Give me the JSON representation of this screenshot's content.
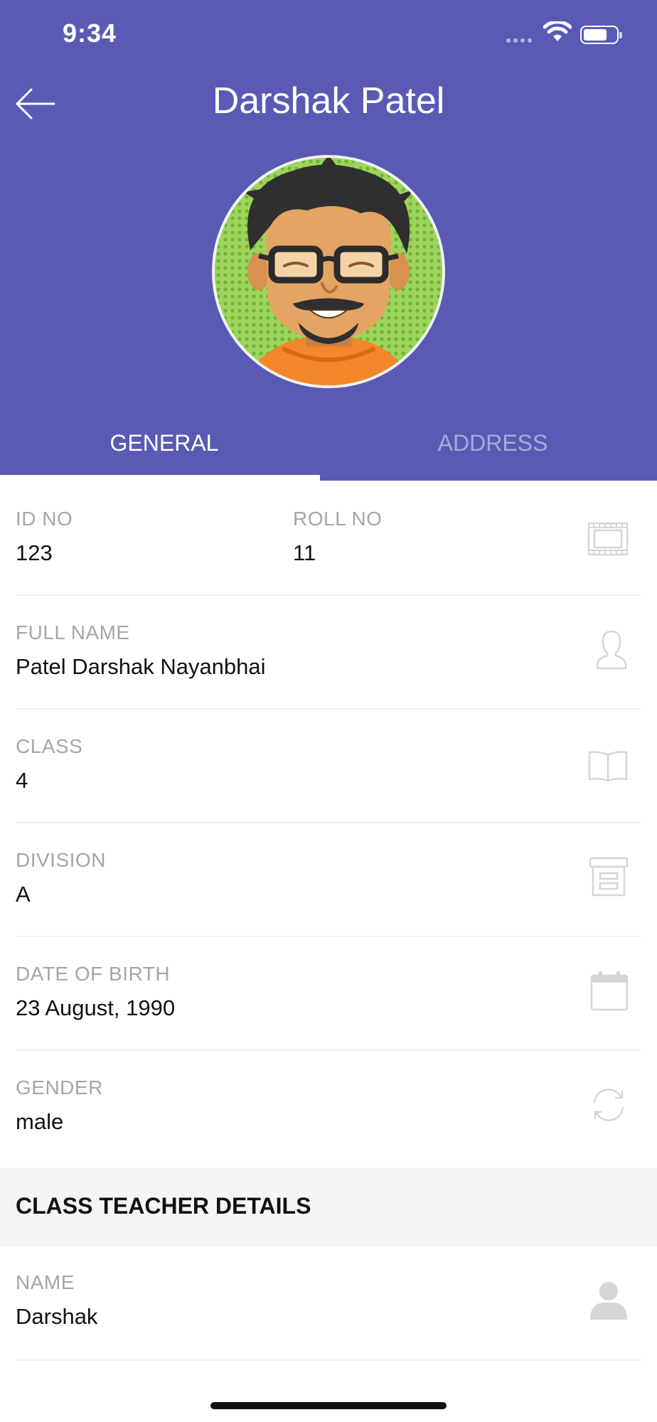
{
  "status_bar": {
    "time": "9:34"
  },
  "header": {
    "title": "Darshak Patel",
    "color": "#5a5ab5"
  },
  "tabs": [
    {
      "label": "GENERAL",
      "active": true
    },
    {
      "label": "ADDRESS",
      "active": false
    }
  ],
  "general": {
    "id_no": {
      "label": "ID NO",
      "value": "123"
    },
    "roll_no": {
      "label": "ROLL NO",
      "value": "11",
      "icon": "film-strip-icon"
    },
    "full_name": {
      "label": "FULL NAME",
      "value": "Patel Darshak Nayanbhai",
      "icon": "person-outline-icon"
    },
    "class": {
      "label": "CLASS",
      "value": "4",
      "icon": "open-book-icon"
    },
    "division": {
      "label": "DIVISION",
      "value": "A",
      "icon": "archive-box-icon"
    },
    "dob": {
      "label": "DATE OF BIRTH",
      "value": "23 August, 1990",
      "icon": "calendar-icon"
    },
    "gender": {
      "label": "GENDER",
      "value": "male",
      "icon": "refresh-icon"
    }
  },
  "class_teacher": {
    "title": "CLASS TEACHER DETAILS",
    "name": {
      "label": "NAME",
      "value": "Darshak",
      "icon": "person-filled-icon"
    }
  }
}
